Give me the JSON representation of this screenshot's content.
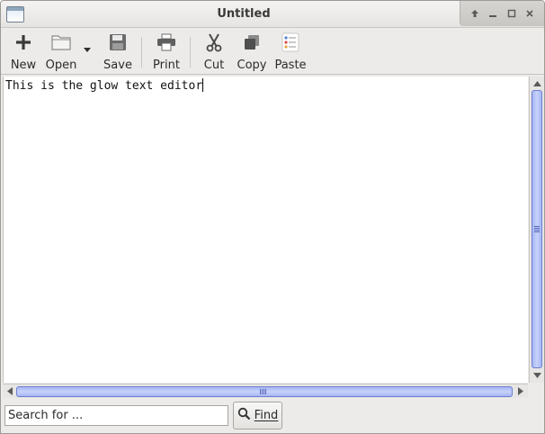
{
  "window": {
    "title": "Untitled"
  },
  "toolbar": {
    "new_label": "New",
    "open_label": "Open",
    "save_label": "Save",
    "print_label": "Print",
    "cut_label": "Cut",
    "copy_label": "Copy",
    "paste_label": "Paste"
  },
  "editor": {
    "text": "This is the glow text editor"
  },
  "search": {
    "placeholder": "Search for ...",
    "find_label": "Find"
  },
  "colors": {
    "scrollbar_thumb": "#a7b6f5",
    "window_bg": "#ecebe9"
  },
  "icons": [
    "app-window-icon",
    "rollup-icon",
    "minimize-icon",
    "maximize-icon",
    "close-icon",
    "plus-icon",
    "folder-icon",
    "floppy-disk-icon",
    "printer-icon",
    "scissors-icon",
    "copy-icon",
    "paste-icon",
    "magnifier-icon"
  ]
}
